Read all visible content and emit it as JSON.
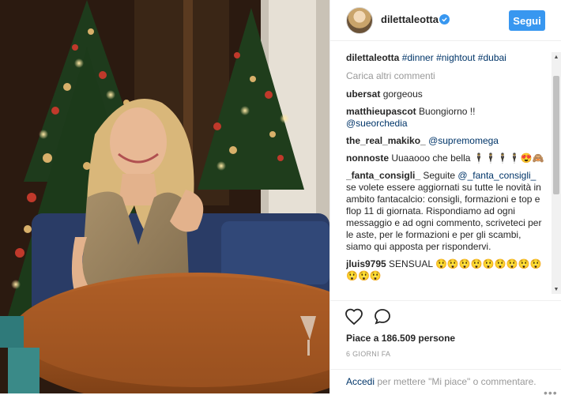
{
  "post": {
    "username": "dilettaleotta",
    "follow_label": "Segui",
    "caption": {
      "username": "dilettaleotta",
      "tags": [
        "#dinner",
        "#nightout",
        "#dubai"
      ]
    },
    "load_more": "Carica altri commenti",
    "comments": [
      {
        "user": "ubersat",
        "text": "gorgeous",
        "mention": ""
      },
      {
        "user": "matthieupascot",
        "text": "Buongiorno !!",
        "mention": "@sueorchedia"
      },
      {
        "user": "the_real_makiko_",
        "text": "",
        "mention": "@supremomega"
      },
      {
        "user": "nonnoste",
        "text": "Uuaaooo che bella 🕴🕴🕴🕴😍🙈",
        "mention": ""
      },
      {
        "user": "_fanta_consigli_",
        "text": "Seguite",
        "mention": "@_fanta_consigli_",
        "text2": "se volete essere aggiornati su tutte le novità in ambito fantacalcio: consigli, formazioni e top e flop 11 di giornata. Rispondiamo ad ogni messaggio e ad ogni commento, scriveteci per le aste, per le formazioni e per gli scambi, siamo qui apposta per rispondervi."
      },
      {
        "user": "jluis9795",
        "text": "SENSUAL 😲😲😲😲😲😲😲😲😲😲😲😲",
        "mention": ""
      }
    ],
    "likes": "Piace a 186.509 persone",
    "date": "6 GIORNI FA",
    "login_link": "Accedi",
    "login_text": "per mettere \"Mi piace\" o commentare.",
    "more_dots": "•••"
  },
  "icons": {
    "heart": "heart-icon",
    "comment": "comment-icon",
    "verified": "verified-badge-icon",
    "scroll_up": "▲",
    "scroll_down": "▼"
  },
  "colors": {
    "accent": "#3897f0",
    "link": "#003569",
    "muted": "#999999"
  }
}
